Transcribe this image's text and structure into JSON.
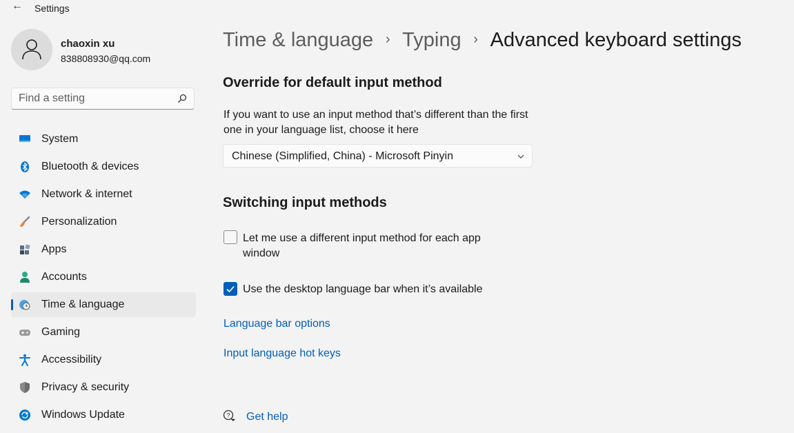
{
  "window": {
    "title": "Settings",
    "back_glyph": "←"
  },
  "user": {
    "name": "chaoxin xu",
    "email": "838808930@qq.com"
  },
  "search": {
    "placeholder": "Find a setting"
  },
  "sidebar": {
    "items": [
      {
        "label": "System",
        "icon": "system-icon",
        "color": "#0078d4"
      },
      {
        "label": "Bluetooth & devices",
        "icon": "bluetooth-icon",
        "color": "#0078d4"
      },
      {
        "label": "Network & internet",
        "icon": "wifi-icon",
        "color": "#0078d4"
      },
      {
        "label": "Personalization",
        "icon": "brush-icon",
        "color": "#e8823a"
      },
      {
        "label": "Apps",
        "icon": "apps-icon",
        "color": "#5b6e84"
      },
      {
        "label": "Accounts",
        "icon": "person-icon",
        "color": "#2bab86"
      },
      {
        "label": "Time & language",
        "icon": "globe-clock-icon",
        "color": "#0078d4",
        "selected": true
      },
      {
        "label": "Gaming",
        "icon": "gamepad-icon",
        "color": "#7a7a7a"
      },
      {
        "label": "Accessibility",
        "icon": "accessibility-icon",
        "color": "#0078d4"
      },
      {
        "label": "Privacy & security",
        "icon": "shield-icon",
        "color": "#7a7a7a"
      },
      {
        "label": "Windows Update",
        "icon": "update-icon",
        "color": "#0078d4"
      }
    ]
  },
  "breadcrumb": {
    "items": [
      "Time & language",
      "Typing"
    ],
    "separator": "›",
    "current": "Advanced keyboard settings"
  },
  "override": {
    "heading": "Override for default input method",
    "description": "If you want to use an input method that’s different than the first one in your language list, choose it here",
    "selected_value": "Chinese (Simplified, China) - Microsoft Pinyin"
  },
  "switching": {
    "heading": "Switching input methods",
    "checkboxes": [
      {
        "label": "Let me use a different input method for each app window",
        "checked": false
      },
      {
        "label": "Use the desktop language bar when it’s available",
        "checked": true
      }
    ]
  },
  "links": {
    "language_bar_options": "Language bar options",
    "hot_keys": "Input language hot keys"
  },
  "help": {
    "label": "Get help"
  },
  "colors": {
    "accent": "#005fb8",
    "background": "#f3f3f3",
    "selected_nav": "#e9e9e9"
  }
}
